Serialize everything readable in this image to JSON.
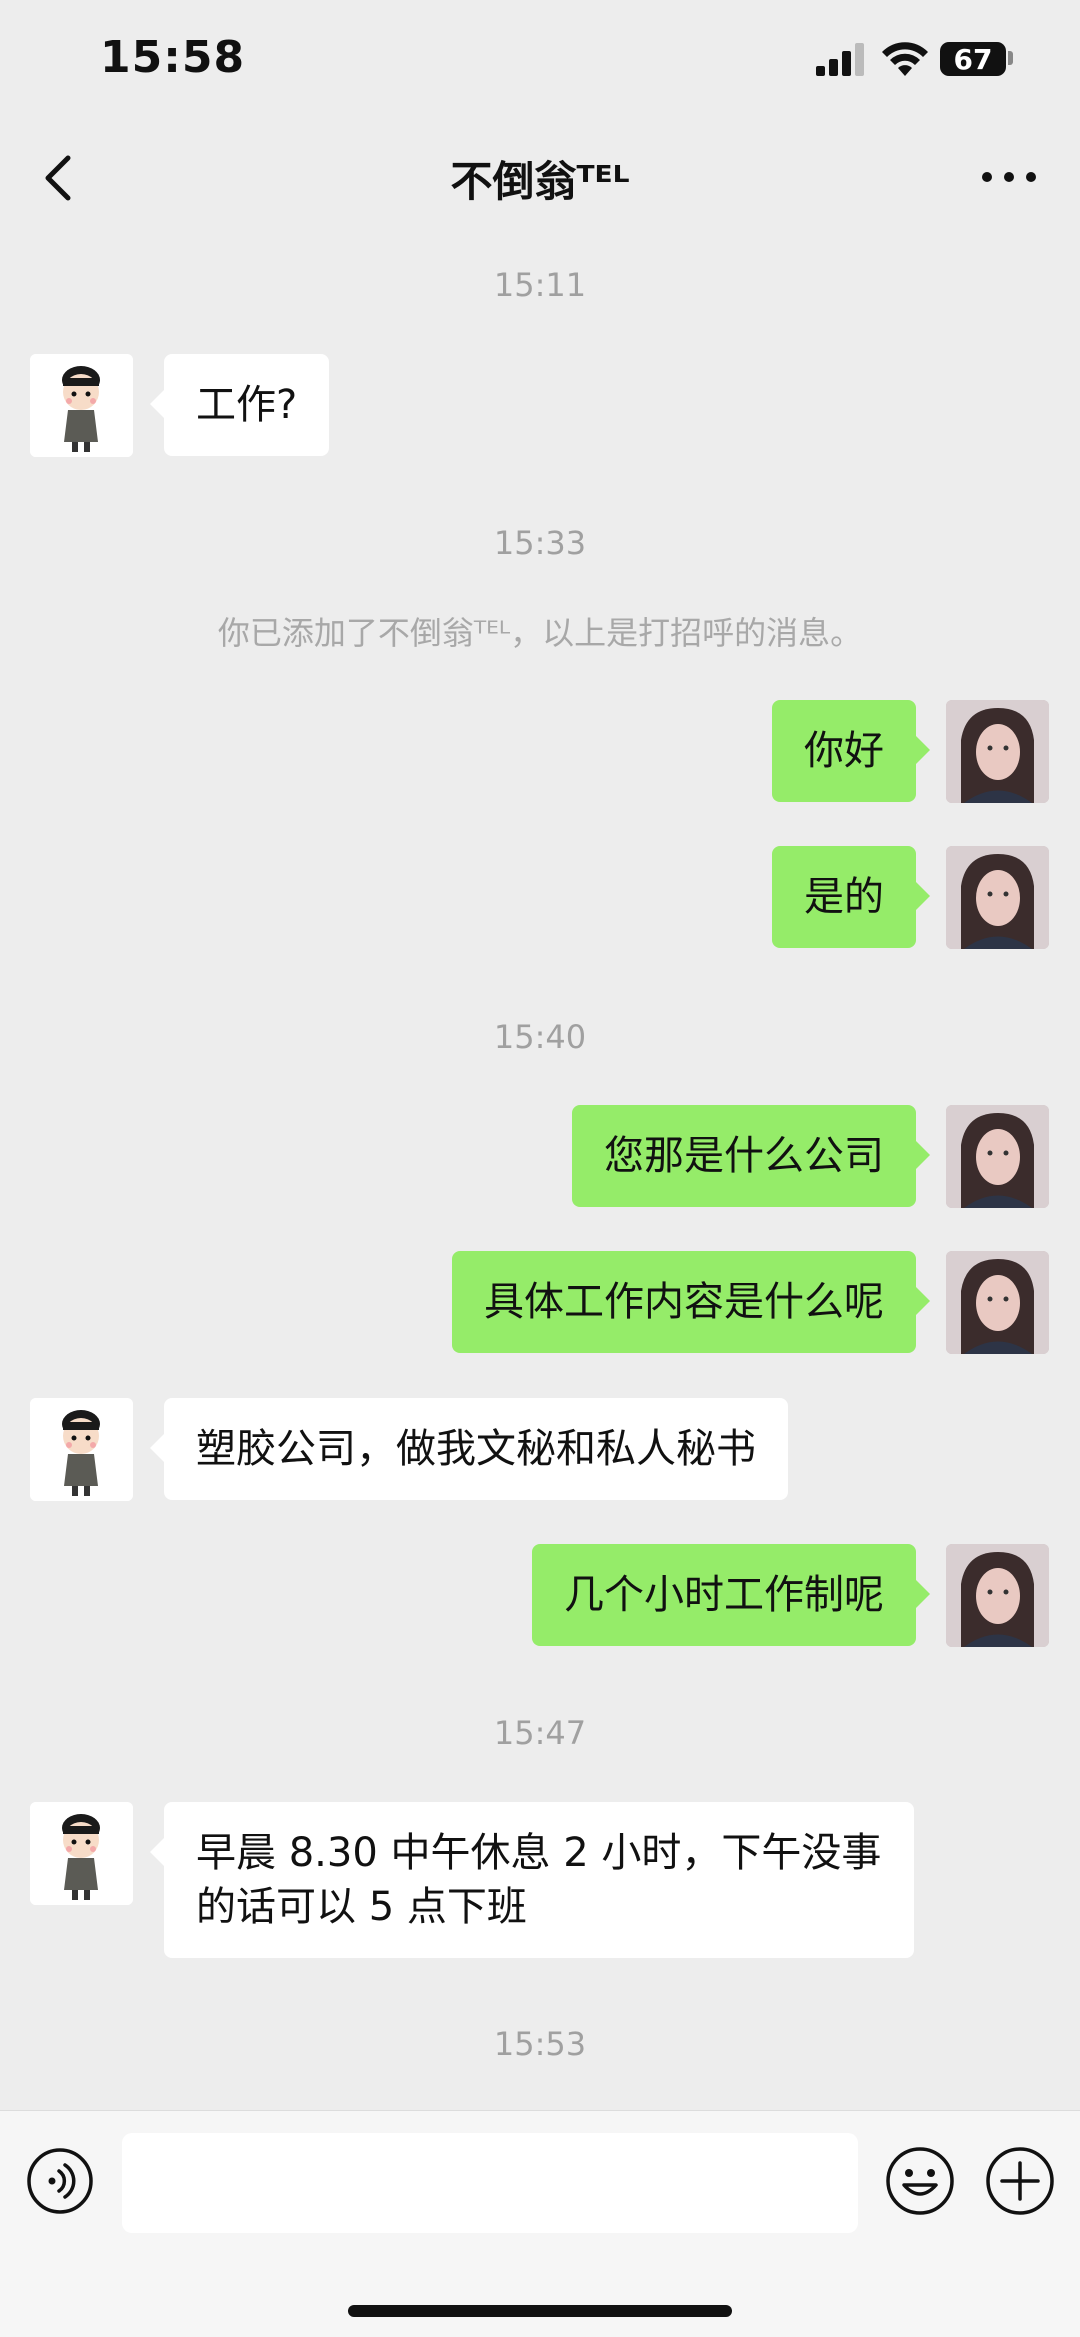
{
  "status_bar": {
    "time": "15:58",
    "battery": "67"
  },
  "nav": {
    "title": "不倒翁ᵀᴱᴸ",
    "back_icon": "chevron-left-icon",
    "more_icon": "more-dots-icon"
  },
  "chat": {
    "items": [
      {
        "type": "time",
        "text": "15:11"
      },
      {
        "type": "msg",
        "side": "left",
        "text": "工作?"
      },
      {
        "type": "time",
        "text": "15:33"
      },
      {
        "type": "system",
        "text": "你已添加了不倒翁ᵀᴱᴸ，以上是打招呼的消息。"
      },
      {
        "type": "msg",
        "side": "right",
        "text": "你好"
      },
      {
        "type": "msg",
        "side": "right",
        "text": "是的"
      },
      {
        "type": "time",
        "text": "15:40"
      },
      {
        "type": "msg",
        "side": "right",
        "text": "您那是什么公司"
      },
      {
        "type": "msg",
        "side": "right",
        "text": "具体工作内容是什么呢"
      },
      {
        "type": "msg",
        "side": "left",
        "text": "塑胶公司，做我文秘和私人秘书"
      },
      {
        "type": "msg",
        "side": "right",
        "text": "几个小时工作制呢"
      },
      {
        "type": "time",
        "text": "15:47"
      },
      {
        "type": "msg",
        "side": "left",
        "text": "早晨 8.30 中午休息 2 小时，下午没事的话可以 5 点下班"
      },
      {
        "type": "time",
        "text": "15:53"
      }
    ]
  },
  "input_bar": {
    "value": "",
    "voice_icon": "voice-icon",
    "emoji_icon": "emoji-icon",
    "plus_icon": "plus-icon"
  },
  "colors": {
    "background": "#ededed",
    "sent_bubble": "#95ec69",
    "received_bubble": "#ffffff"
  }
}
